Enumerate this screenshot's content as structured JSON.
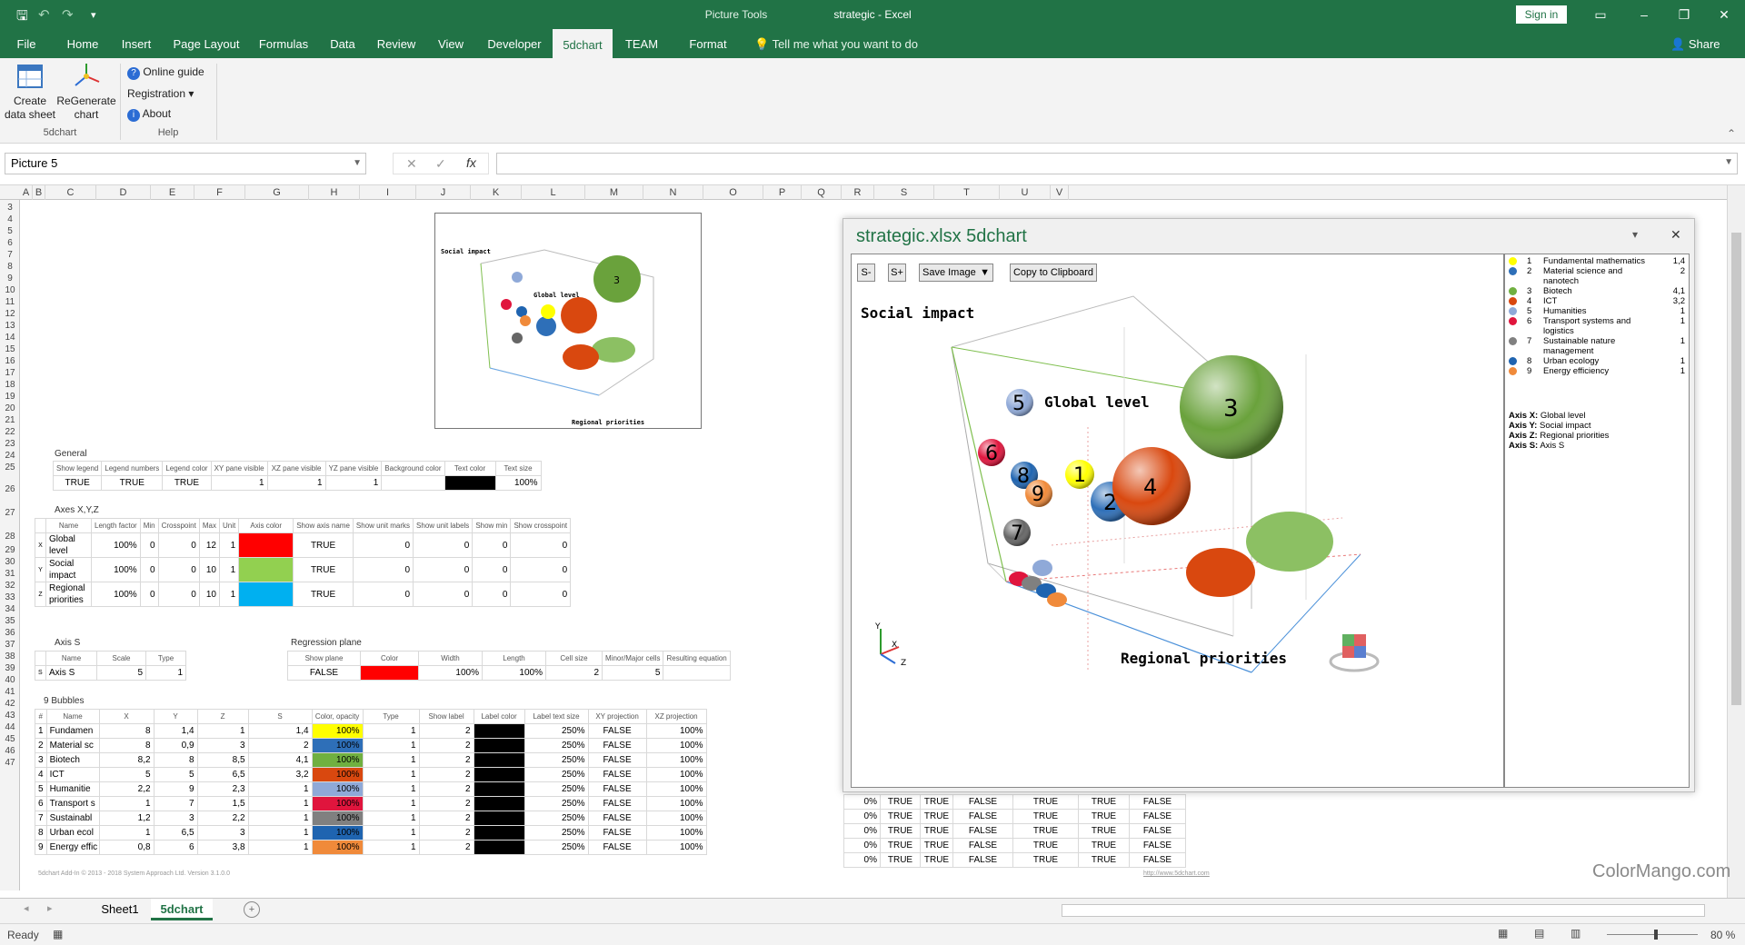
{
  "app": {
    "doc_title": "strategic  -  Excel",
    "picture_tools": "Picture Tools",
    "sign_in": "Sign in",
    "share": "Share",
    "tell_me": "Tell me what you want to do"
  },
  "tabs": [
    "File",
    "Home",
    "Insert",
    "Page Layout",
    "Formulas",
    "Data",
    "Review",
    "View",
    "Developer",
    "5dchart",
    "TEAM",
    "Format"
  ],
  "ribbon": {
    "create": "Create\ndata sheet",
    "regen": "ReGenerate\nchart",
    "group1": "5dchart",
    "online": "Online guide",
    "registration": "Registration ▾",
    "about": "About",
    "group2": "Help"
  },
  "namebox": "Picture 5",
  "columns": [
    "A",
    "B",
    "C",
    "D",
    "E",
    "F",
    "G",
    "H",
    "I",
    "J",
    "K",
    "L",
    "M",
    "N",
    "O",
    "P",
    "Q",
    "R",
    "S",
    "T",
    "U",
    "V"
  ],
  "rows": [
    "3",
    "4",
    "5",
    "6",
    "7",
    "8",
    "9",
    "10",
    "11",
    "12",
    "13",
    "14",
    "15",
    "16",
    "17",
    "18",
    "19",
    "20",
    "21",
    "22",
    "23",
    "24",
    "25",
    "26",
    "27",
    "28",
    "29",
    "30",
    "31",
    "32",
    "33",
    "34",
    "35",
    "36",
    "37",
    "38",
    "39",
    "40",
    "41",
    "42",
    "43",
    "44",
    "45",
    "46",
    "47"
  ],
  "general": {
    "title": "General",
    "headers": [
      "Show legend",
      "Legend numbers",
      "Legend color",
      "XY pane visible",
      "XZ pane visible",
      "YZ pane visible",
      "Background color",
      "Text color",
      "Text size"
    ],
    "values": [
      "TRUE",
      "TRUE",
      "TRUE",
      "1",
      "1",
      "1",
      "",
      "",
      "100%"
    ]
  },
  "axes": {
    "title": "Axes X,Y,Z",
    "headers": [
      "Name",
      "Length factor",
      "Min",
      "Crosspoint",
      "Max",
      "Unit",
      "Axis color",
      "Show axis name",
      "Show unit marks",
      "Show unit labels",
      "Show min",
      "Show crosspoint"
    ],
    "rows": [
      [
        "X",
        "Global level",
        "100%",
        "0",
        "0",
        "12",
        "1",
        "#ff0000",
        "TRUE",
        "0",
        "0",
        "0",
        "0"
      ],
      [
        "Y",
        "Social impact",
        "100%",
        "0",
        "0",
        "10",
        "1",
        "#92d050",
        "TRUE",
        "0",
        "0",
        "0",
        "0"
      ],
      [
        "Z",
        "Regional priorities",
        "100%",
        "0",
        "0",
        "10",
        "1",
        "#00b0f0",
        "TRUE",
        "0",
        "0",
        "0",
        "0"
      ]
    ]
  },
  "axis_s": {
    "title": "Axis S",
    "headers": [
      "Name",
      "Scale",
      "Type"
    ],
    "row": [
      "S",
      "Axis S",
      "5",
      "1"
    ]
  },
  "regression": {
    "title": "Regression plane",
    "headers": [
      "Show plane",
      "Color",
      "Width",
      "Length",
      "Cell size",
      "Minor/Major cells",
      "Resulting equation"
    ],
    "row": [
      "FALSE",
      "#ff0000",
      "100%",
      "100%",
      "2",
      "5",
      ""
    ]
  },
  "bubbles": {
    "title": "9  Bubbles",
    "headers": [
      "#",
      "Name",
      "X",
      "Y",
      "Z",
      "S",
      "Color, opacity",
      "Type",
      "Show label",
      "Label color",
      "Label text size",
      "XY projection",
      "XZ projection"
    ],
    "rows": [
      [
        "1",
        "Fundamen",
        "8",
        "1,4",
        "1",
        "1,4",
        "#ffff00",
        "100%",
        "1",
        "2",
        "250%",
        "FALSE",
        "100%"
      ],
      [
        "2",
        "Material sc",
        "8",
        "0,9",
        "3",
        "2",
        "#2e6fb8",
        "100%",
        "1",
        "2",
        "250%",
        "FALSE",
        "100%"
      ],
      [
        "3",
        "Biotech",
        "8,2",
        "8",
        "8,5",
        "4,1",
        "#70b040",
        "100%",
        "1",
        "2",
        "250%",
        "FALSE",
        "100%"
      ],
      [
        "4",
        "ICT",
        "5",
        "5",
        "6,5",
        "3,2",
        "#d9480f",
        "100%",
        "1",
        "2",
        "250%",
        "FALSE",
        "100%"
      ],
      [
        "5",
        "Humanitie",
        "2,2",
        "9",
        "2,3",
        "1",
        "#8fa9d8",
        "100%",
        "1",
        "2",
        "250%",
        "FALSE",
        "100%"
      ],
      [
        "6",
        "Transport s",
        "1",
        "7",
        "1,5",
        "1",
        "#e0153d",
        "100%",
        "1",
        "2",
        "250%",
        "FALSE",
        "100%"
      ],
      [
        "7",
        "Sustainabl",
        "1,2",
        "3",
        "2,2",
        "1",
        "#808080",
        "100%",
        "1",
        "2",
        "250%",
        "FALSE",
        "100%"
      ],
      [
        "8",
        "Urban ecol",
        "1",
        "6,5",
        "3",
        "1",
        "#1f64b0",
        "100%",
        "1",
        "2",
        "250%",
        "FALSE",
        "100%"
      ],
      [
        "9",
        "Energy effic",
        "0,8",
        "6",
        "3,8",
        "1",
        "#f08a3a",
        "100%",
        "1",
        "2",
        "250%",
        "FALSE",
        "100%"
      ]
    ],
    "tail": [
      [
        "0%",
        "TRUE",
        "TRUE",
        "FALSE",
        "TRUE",
        "TRUE",
        "FALSE"
      ],
      [
        "0%",
        "TRUE",
        "TRUE",
        "FALSE",
        "TRUE",
        "TRUE",
        "FALSE"
      ],
      [
        "0%",
        "TRUE",
        "TRUE",
        "FALSE",
        "TRUE",
        "TRUE",
        "FALSE"
      ],
      [
        "0%",
        "TRUE",
        "TRUE",
        "FALSE",
        "TRUE",
        "TRUE",
        "FALSE"
      ],
      [
        "0%",
        "TRUE",
        "TRUE",
        "FALSE",
        "TRUE",
        "TRUE",
        "FALSE"
      ]
    ]
  },
  "footer": {
    "left": "5dchart Add-In © 2013 - 2018 System Approach Ltd. Version 3.1.0.0",
    "right": "http://www.5dchart.com"
  },
  "chart_panel": {
    "title": "strategic.xlsx 5dchart",
    "s_minus": "S-",
    "s_plus": "S+",
    "save": "Save Image",
    "copy": "Copy to Clipboard",
    "axis_y": "Social impact",
    "axis_x": "Global level",
    "axis_z": "Regional priorities",
    "legend": [
      {
        "n": "1",
        "name": "Fundamental mathematics",
        "v": "1,4",
        "color": "#ffff00"
      },
      {
        "n": "2",
        "name": "Material science and nanotech",
        "v": "2",
        "color": "#2e6fb8"
      },
      {
        "n": "3",
        "name": "Biotech",
        "v": "4,1",
        "color": "#70b040"
      },
      {
        "n": "4",
        "name": "ICT",
        "v": "3,2",
        "color": "#d9480f"
      },
      {
        "n": "5",
        "name": "Humanities",
        "v": "1",
        "color": "#8fa9d8"
      },
      {
        "n": "6",
        "name": "Transport systems and logistics",
        "v": "1",
        "color": "#e0153d"
      },
      {
        "n": "7",
        "name": "Sustainable nature management",
        "v": "1",
        "color": "#808080"
      },
      {
        "n": "8",
        "name": "Urban ecology",
        "v": "1",
        "color": "#1f64b0"
      },
      {
        "n": "9",
        "name": "Energy efficiency",
        "v": "1",
        "color": "#f08a3a"
      }
    ],
    "axes_legend": [
      {
        "k": "Axis X:",
        "v": "Global level"
      },
      {
        "k": "Axis Y:",
        "v": "Social impact"
      },
      {
        "k": "Axis Z:",
        "v": "Regional priorities"
      },
      {
        "k": "Axis S:",
        "v": "Axis S"
      }
    ]
  },
  "sheet_tabs": [
    "Sheet1",
    "5dchart"
  ],
  "status": {
    "ready": "Ready",
    "zoom": "80 %"
  },
  "watermark": "ColorMango.com"
}
